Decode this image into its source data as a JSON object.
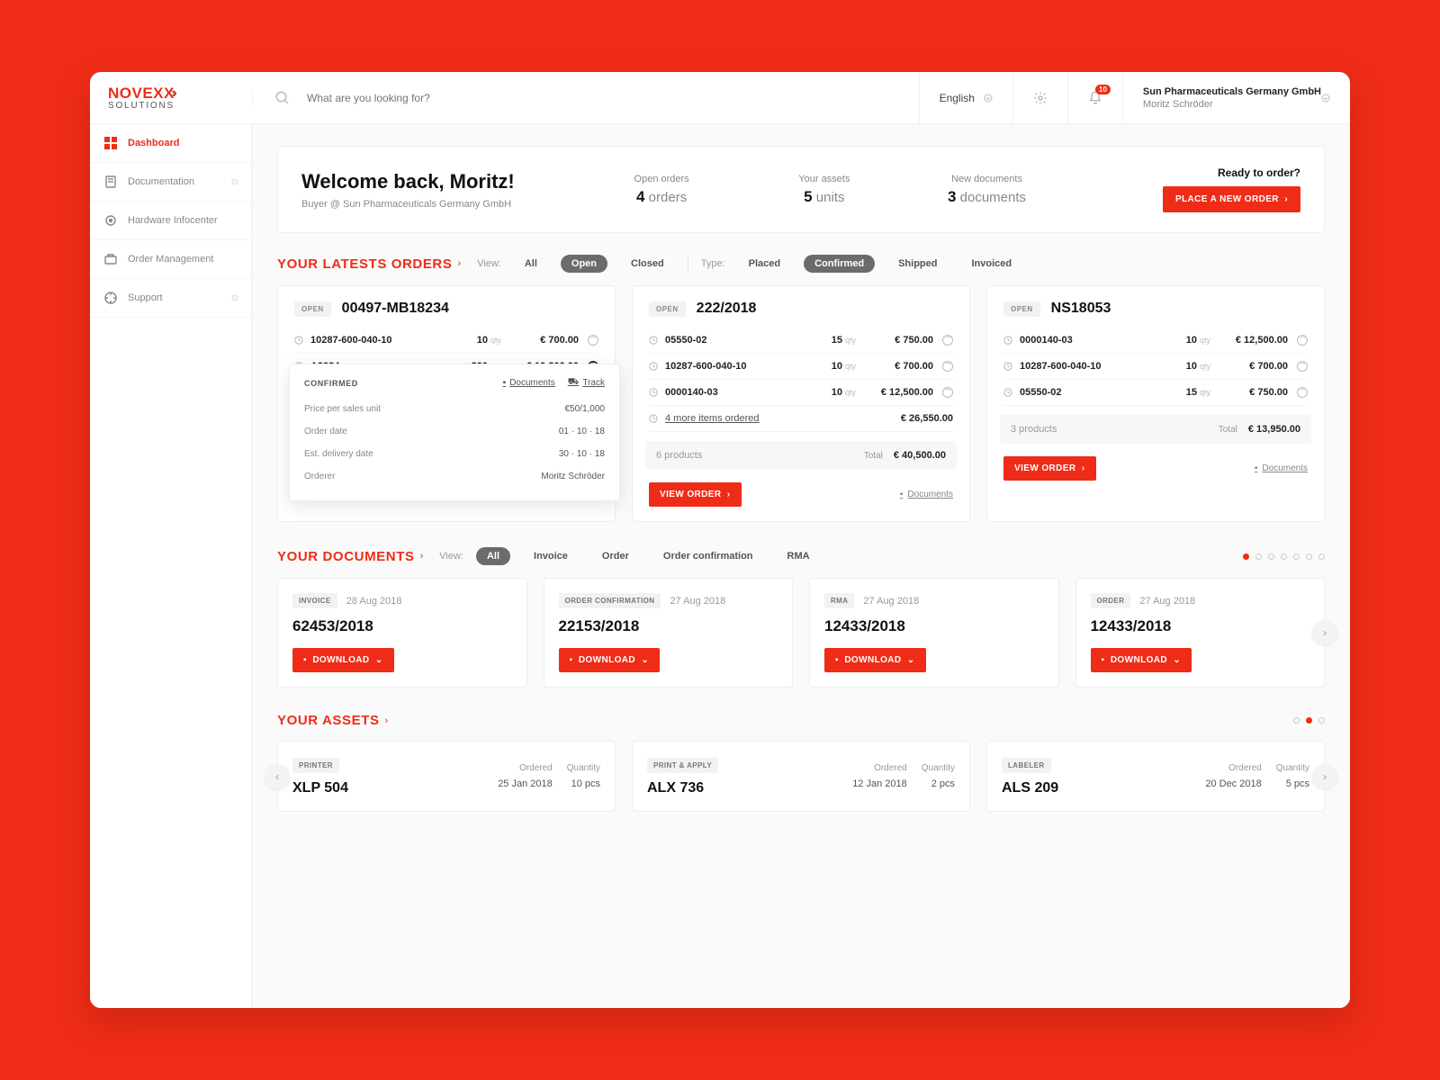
{
  "brand": {
    "name": "NOVEXX",
    "sub": "SOLUTIONS"
  },
  "search": {
    "placeholder": "What are you looking for?"
  },
  "topbar": {
    "language": "English",
    "notification_count": "10",
    "company": "Sun Pharmaceuticals Germany GmbH",
    "user": "Moritz Schröder"
  },
  "nav": [
    {
      "label": "Dashboard",
      "active": true
    },
    {
      "label": "Documentation",
      "chev": true
    },
    {
      "label": "Hardware Infocenter"
    },
    {
      "label": "Order Management"
    },
    {
      "label": "Support",
      "chev": true
    }
  ],
  "hero": {
    "title": "Welcome back, Moritz!",
    "subtitle": "Buyer @ Sun Pharmaceuticals Germany GmbH",
    "stats": [
      {
        "label": "Open orders",
        "value": "4",
        "unit": "orders"
      },
      {
        "label": "Your assets",
        "value": "5",
        "unit": "units"
      },
      {
        "label": "New documents",
        "value": "3",
        "unit": "documents"
      }
    ],
    "cta_label": "Ready to order?",
    "cta_button": "PLACE A NEW ORDER"
  },
  "orders_section": {
    "title": "YOUR LATESTS ORDERS",
    "filters": {
      "view_label": "View:",
      "view": [
        "All",
        "Open",
        "Closed"
      ],
      "view_active": "Open",
      "type_label": "Type:",
      "type": [
        "Placed",
        "Confirmed",
        "Shipped",
        "Invoiced"
      ],
      "type_active": "Confirmed"
    },
    "cards": [
      {
        "status": "OPEN",
        "number": "00497-MB18234",
        "lines": [
          {
            "sku": "10287-600-040-10",
            "qty": "10",
            "unit": "qty",
            "price": "€ 700.00"
          },
          {
            "sku": "A9034",
            "qty": "200",
            "unit": "qty",
            "price": "€ 10,200.00",
            "filled": true
          }
        ],
        "popover": {
          "status": "CONFIRMED",
          "links": {
            "documents": "Documents",
            "track": "Track"
          },
          "rows": [
            {
              "k": "Price per sales unit",
              "v": "€50/1,000"
            },
            {
              "k": "Order date",
              "v": "01 · 10 · 18"
            },
            {
              "k": "Est. delivery date",
              "v": "30 · 10 · 18"
            },
            {
              "k": "Orderer",
              "v": "Moritz Schröder"
            }
          ]
        }
      },
      {
        "status": "OPEN",
        "number": "222/2018",
        "lines": [
          {
            "sku": "05550-02",
            "qty": "15",
            "unit": "qty",
            "price": "€ 750.00"
          },
          {
            "sku": "10287-600-040-10",
            "qty": "10",
            "unit": "qty",
            "price": "€ 700.00"
          },
          {
            "sku": "0000140-03",
            "qty": "10",
            "unit": "qty",
            "price": "€ 12,500.00"
          }
        ],
        "more": {
          "text": "4 more items ordered",
          "price": "€ 26,550.00"
        },
        "totals": {
          "products": "6 products",
          "label": "Total",
          "value": "€ 40,500.00"
        },
        "view_btn": "VIEW ORDER",
        "docs": "Documents"
      },
      {
        "status": "OPEN",
        "number": "NS18053",
        "lines": [
          {
            "sku": "0000140-03",
            "qty": "10",
            "unit": "qty",
            "price": "€ 12,500.00"
          },
          {
            "sku": "10287-600-040-10",
            "qty": "10",
            "unit": "qty",
            "price": "€ 700.00"
          },
          {
            "sku": "05550-02",
            "qty": "15",
            "unit": "qty",
            "price": "€ 750.00"
          }
        ],
        "totals": {
          "products": "3 products",
          "label": "Total",
          "value": "€ 13,950.00"
        },
        "view_btn": "VIEW ORDER",
        "docs": "Documents"
      }
    ]
  },
  "documents_section": {
    "title": "YOUR DOCUMENTS",
    "filters": {
      "view_label": "View:",
      "items": [
        "All",
        "Invoice",
        "Order",
        "Order confirmation",
        "RMA"
      ],
      "active": "All"
    },
    "cards": [
      {
        "type": "INVOICE",
        "date": "28 Aug 2018",
        "number": "62453/2018",
        "btn": "DOWNLOAD"
      },
      {
        "type": "ORDER CONFIRMATION",
        "date": "27 Aug 2018",
        "number": "22153/2018",
        "btn": "DOWNLOAD"
      },
      {
        "type": "RMA",
        "date": "27 Aug 2018",
        "number": "12433/2018",
        "btn": "DOWNLOAD"
      },
      {
        "type": "ORDER",
        "date": "27 Aug 2018",
        "number": "12433/2018",
        "btn": "DOWNLOAD"
      }
    ]
  },
  "assets_section": {
    "title": "YOUR ASSETS",
    "cards": [
      {
        "type": "PRINTER",
        "name": "XLP 504",
        "ordered_l": "Ordered",
        "ordered": "25 Jan 2018",
        "qty_l": "Quantity",
        "qty": "10 pcs"
      },
      {
        "type": "PRINT & APPLY",
        "name": "ALX 736",
        "ordered_l": "Ordered",
        "ordered": "12 Jan 2018",
        "qty_l": "Quantity",
        "qty": "2 pcs"
      },
      {
        "type": "LABELER",
        "name": "ALS 209",
        "ordered_l": "Ordered",
        "ordered": "20 Dec 2018",
        "qty_l": "Quantity",
        "qty": "5 pcs"
      }
    ]
  }
}
